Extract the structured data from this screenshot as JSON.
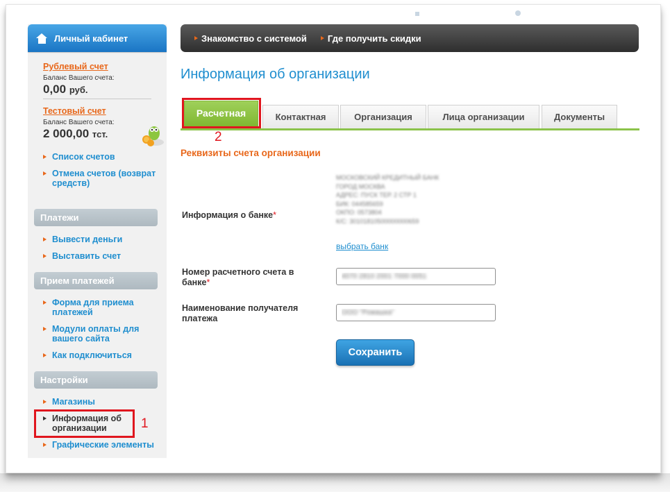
{
  "sidebar": {
    "header": "Личный кабинет",
    "accounts": [
      {
        "name": "Рублевый счет",
        "balance_label": "Баланс Вашего счета:",
        "amount": "0,00",
        "currency": "руб."
      },
      {
        "name": "Тестовый счет",
        "balance_label": "Баланс Вашего счета:",
        "amount": "2 000,00",
        "currency": "тст."
      }
    ],
    "account_links": [
      "Список счетов",
      "Отмена счетов (возврат средств)"
    ],
    "sections": [
      {
        "title": "Платежи",
        "items": [
          "Вывести деньги",
          "Выставить счет"
        ]
      },
      {
        "title": "Прием платежей",
        "items": [
          "Форма для приема платежей",
          "Модули оплаты для вашего сайта",
          "Как подключиться"
        ]
      },
      {
        "title": "Настройки",
        "items": [
          "Магазины",
          "Информация об организации",
          "Графические элементы"
        ]
      }
    ]
  },
  "topnav": {
    "items": [
      "Знакомство с системой",
      "Где получить скидки"
    ]
  },
  "page_title": "Информация об организации",
  "tabs": [
    {
      "label": "Расчетная",
      "active": true
    },
    {
      "label": "Контактная",
      "active": false
    },
    {
      "label": "Организация",
      "active": false
    },
    {
      "label": "Лица организации",
      "active": false
    },
    {
      "label": "Документы",
      "active": false
    }
  ],
  "section_title": "Реквизиты счета организации",
  "form": {
    "bank_label": "Информация о банке",
    "bank_info_lines": [
      "МОСКОВСКИЙ КРЕДИТНЫЙ БАНК",
      "ГОРОД МОСКВА",
      "АДРЕС: ПУСК ТЕР. 2 СТР 1",
      "БИК: 044585659",
      "ОКПО: 0573804",
      "К/С: 30101810500000000659"
    ],
    "bank_link": "выбрать банк",
    "account_label": "Номер расчетного счета в банке",
    "account_value": "4070 2810 2001 7000 0051",
    "recipient_label": "Наименование получателя платежа",
    "recipient_value": "ООО \"Ромашка\"",
    "required_mark": "*",
    "save_button": "Сохранить"
  },
  "annotations": [
    "1",
    "2"
  ],
  "colors": {
    "accent_blue": "#1f8ecf",
    "accent_orange": "#e8671a",
    "tab_green": "#8bc34a",
    "highlight_red": "#e0161e"
  }
}
